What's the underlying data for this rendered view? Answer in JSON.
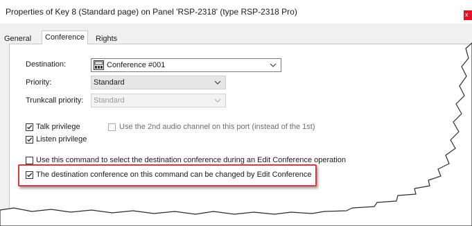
{
  "window": {
    "title": "Properties of Key 8 (Standard page) on Panel 'RSP-2318' (type RSP-2318 Pro)",
    "close_glyph": "x"
  },
  "tabs": [
    {
      "label": "General",
      "active": false
    },
    {
      "label": "Conference",
      "active": true
    },
    {
      "label": "Rights",
      "active": false
    }
  ],
  "form": {
    "destination_label": "Destination:",
    "destination_value": "Conference #001",
    "destination_icon": "conference-icon",
    "priority_label": "Priority:",
    "priority_value": "Standard",
    "trunkcall_label": "Trunkcall priority:",
    "trunkcall_value": "Standard"
  },
  "checkboxes": {
    "talk": {
      "label": "Talk privilege",
      "checked": true
    },
    "listen": {
      "label": "Listen privilege",
      "checked": true
    },
    "second_audio": {
      "label": "Use the 2nd audio channel on this port (instead of the 1st)",
      "checked": false
    },
    "select_dest": {
      "label": "Use this command to select the destination conference during an Edit Conference operation",
      "checked": false
    },
    "changeable": {
      "label": "The destination conference on this command can be changed by Edit Conference",
      "checked": true
    }
  },
  "colors": {
    "highlight_border": "#d9363e",
    "close_button": "#e81123"
  }
}
